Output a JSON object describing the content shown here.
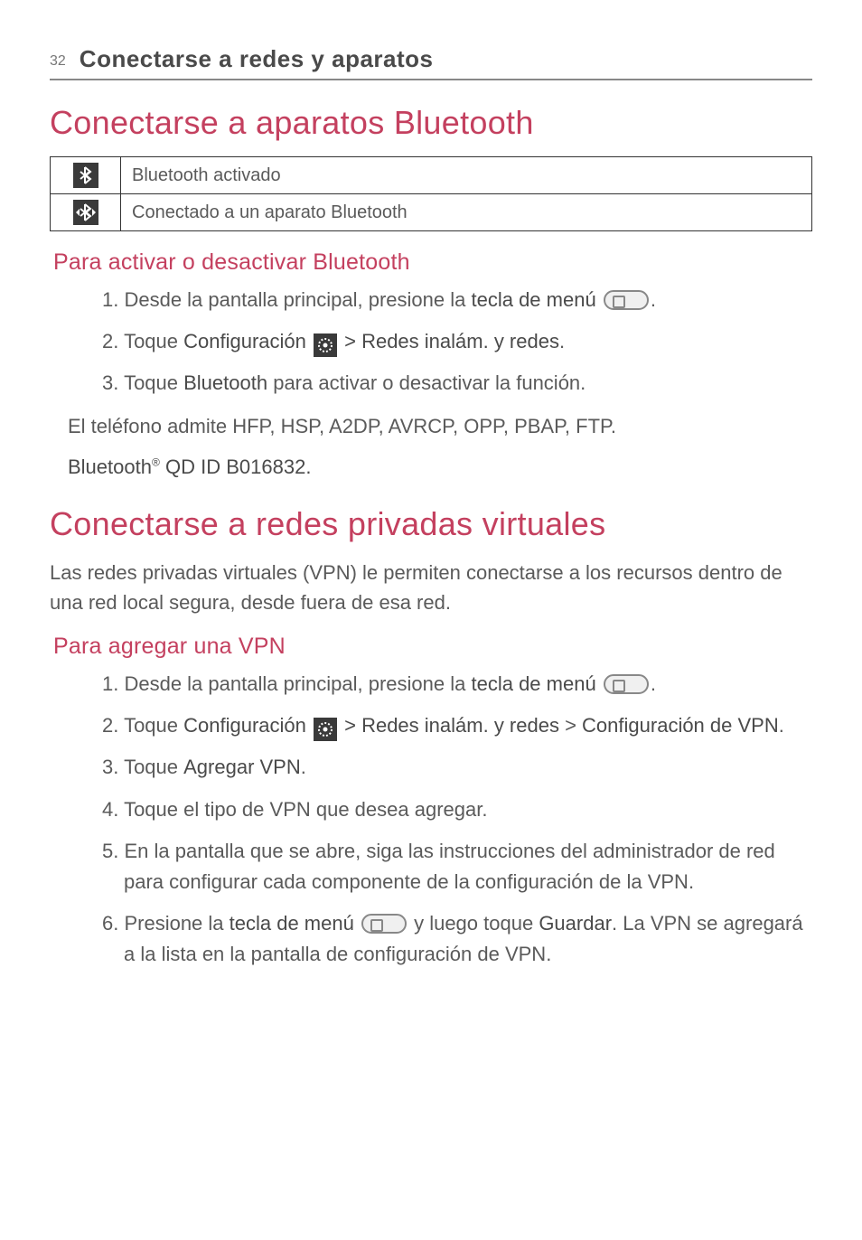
{
  "page": {
    "number": "32",
    "running_head": "Conectarse a redes y aparatos"
  },
  "s1": {
    "title": "Conectarse a aparatos Bluetooth",
    "row1": "Bluetooth activado",
    "row2": "Conectado a un aparato Bluetooth",
    "sub": "Para activar o desactivar Bluetooth",
    "li1a": "1. Desde la pantalla principal, presione la ",
    "li1b": "tecla de menú",
    "li1c": ".",
    "li2a": "2. Toque ",
    "li2b": "Configuración",
    "li2c": " > ",
    "li2d": "Redes inalám. y redes",
    "li2e": ".",
    "li3a": "3. Toque ",
    "li3b": "Bluetooth",
    "li3c": " para activar o desactivar la función.",
    "p1": "El teléfono admite HFP, HSP, A2DP, AVRCP, OPP, PBAP, FTP.",
    "p2a": "Bluetooth",
    "p2b": " QD ID B016832."
  },
  "s2": {
    "title": "Conectarse a redes privadas virtuales",
    "intro": "Las redes privadas virtuales (VPN) le permiten conectarse a los recursos dentro de una red local segura, desde fuera de esa red.",
    "sub": "Para agregar una VPN",
    "li1a": "1. Desde la pantalla principal, presione la ",
    "li1b": "tecla de menú",
    "li1c": ".",
    "li2a": "2. Toque ",
    "li2b": "Configuración",
    "li2c": " > ",
    "li2d": "Redes inalám. y redes",
    "li2e": " > ",
    "li2f": "Configuración de VPN",
    "li2g": ".",
    "li3a": "3. Toque ",
    "li3b": "Agregar VPN",
    "li3c": ".",
    "li4": "4. Toque el tipo de VPN que desea agregar.",
    "li5": "5. En la pantalla que se abre, siga las instrucciones del administrador de red para configurar cada componente de la configuración de la VPN.",
    "li6a": "6. Presione la ",
    "li6b": "tecla de menú",
    "li6c": " y luego toque ",
    "li6d": "Guardar",
    "li6e": ". La VPN se agregará a la lista en la pantalla de configuración de VPN."
  }
}
